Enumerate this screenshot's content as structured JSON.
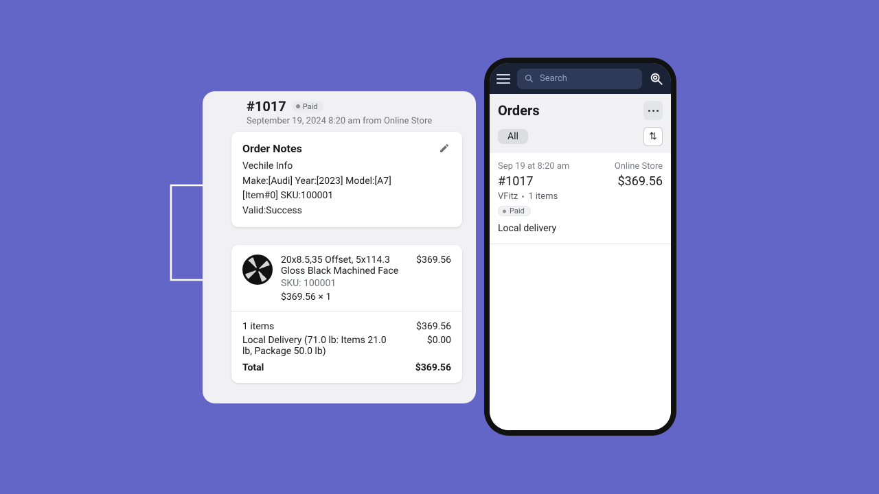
{
  "desktop": {
    "order_id": "#1017",
    "paid_label": "Paid",
    "meta": "September 19, 2024 8:20 am from Online Store",
    "notes": {
      "title": "Order Notes",
      "l1": "Vechile Info",
      "l2": "Make:[Audi] Year:[2023] Model:[A7]",
      "l3": "[Item#0] SKU:100001",
      "l4": "Valid:Success"
    },
    "product": {
      "name_l1": "20x8.5,35 Offset, 5x114.3",
      "name_l2": "Gloss Black Machined Face",
      "sku": "SKU: 100001",
      "unit_qty": "$369.56   ×   1",
      "price": "$369.56"
    },
    "totals": {
      "items_label": "1 items",
      "items_amount": "$369.56",
      "delivery_label": "Local Delivery (71.0 lb: Items 21.0 lb, Package 50.0 lb)",
      "delivery_amount": "$0.00",
      "total_label": "Total",
      "total_amount": "$369.56"
    }
  },
  "phone": {
    "search_placeholder": "Search",
    "orders_title": "Orders",
    "filter_all": "All",
    "item": {
      "date": "Sep 19 at 8:20 am",
      "channel": "Online Store",
      "id": "#1017",
      "amount": "$369.56",
      "customer": "VFitz",
      "count": "1 items",
      "paid": "Paid",
      "delivery": "Local delivery"
    }
  }
}
